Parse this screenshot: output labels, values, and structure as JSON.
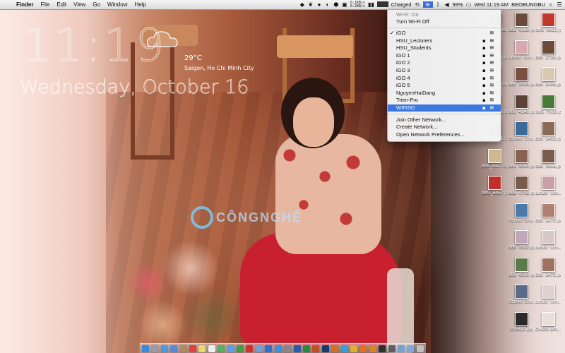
{
  "menubar": {
    "app_name": "Finder",
    "menus": [
      "File",
      "Edit",
      "View",
      "Go",
      "Window",
      "Help"
    ],
    "net_up": "0.1KB/s",
    "net_down": "0.2KB/s",
    "battery_percent": "99%",
    "battery_level": 0.99,
    "battery_status": "Charged",
    "clock": "Wed 11:19 AM",
    "username": "BEOBUNGBU"
  },
  "clock_widget": {
    "time": "11:19",
    "temperature": "29°C",
    "city": "Saigon, Ho Chi Minh City",
    "date": "Wednesday, October 16"
  },
  "watermark": {
    "text": "CÔNGNGHỆ"
  },
  "wifi_menu": {
    "status": "Wi-Fi: On",
    "toggle": "Turn Wi-Fi Off",
    "networks": [
      {
        "name": "iGO",
        "connected": true,
        "locked": false
      },
      {
        "name": "HSU_Lecturers",
        "connected": false,
        "locked": true
      },
      {
        "name": "HSU_Students",
        "connected": false,
        "locked": true
      },
      {
        "name": "iGO 1",
        "connected": false,
        "locked": true
      },
      {
        "name": "iGO 2",
        "connected": false,
        "locked": true
      },
      {
        "name": "iGO 3",
        "connected": false,
        "locked": true
      },
      {
        "name": "iGO 4",
        "connected": false,
        "locked": true
      },
      {
        "name": "iGO 5",
        "connected": false,
        "locked": true
      },
      {
        "name": "NguyenHaiDang",
        "connected": false,
        "locked": true
      },
      {
        "name": "Trien-Pro",
        "connected": false,
        "locked": true
      },
      {
        "name": "WIFISD",
        "connected": false,
        "locked": true,
        "highlighted": true
      }
    ],
    "actions": [
      "Join Other Network...",
      "Create Network...",
      "Open Network Preferences..."
    ]
  },
  "desktop_icons": [
    {
      "label": "IMG_6422.jpg",
      "color": "#c0392b"
    },
    {
      "label": "888_3726.jpg",
      "color": "#6b4a3a"
    },
    {
      "label": "888_3466.jpg",
      "color": "#d8c8b0"
    },
    {
      "label": "IMG_7008.jpg",
      "color": "#4a7a3a"
    },
    {
      "label": "888_3493.jpg",
      "color": "#8a6a5a"
    },
    {
      "label": "888_3566.jpg",
      "color": "#7a5a4a"
    },
    {
      "label": "tumblr_mm...jpg",
      "color": "#c9a0a8"
    },
    {
      "label": "888_3472.jpg",
      "color": "#b08070"
    },
    {
      "label": "tumblr_mm...jpg",
      "color": "#d9c8c8"
    },
    {
      "label": "888_3475.jpg",
      "color": "#a07060"
    },
    {
      "label": "tumblr_mm...jpg",
      "color": "#e0d0d0"
    },
    {
      "label": "CHON MA...AO",
      "color": "#e8e0d8"
    },
    {
      "label": "888_4168.jpg",
      "color": "#6a4a3a"
    },
    {
      "label": "tumblr_mm...jpg",
      "color": "#d8a8b0"
    },
    {
      "label": "888_3989.jpg",
      "color": "#7a5040"
    },
    {
      "label": "888_4148.jpg",
      "color": "#5a4035"
    },
    {
      "label": "Screen Sho...PM",
      "color": "#3a6a9a"
    },
    {
      "label": "888_3990.jpg",
      "color": "#8a6050"
    },
    {
      "label": "888_4708.jpg",
      "color": "#7a5a4a"
    },
    {
      "label": "Screen Sho...PM",
      "color": "#4a7aaa"
    },
    {
      "label": "888_3992.jpg",
      "color": "#c0a8b8"
    },
    {
      "label": "888_4599.jpg",
      "color": "#5a7a4a"
    },
    {
      "label": "Screen Sho...PM",
      "color": "#5a6a8a"
    },
    {
      "label": "235810.jpg",
      "color": "#2a2a2a"
    },
    {
      "label": "Screen Sho...AM",
      "color": "#3a5a8a"
    },
    {
      "label": "888_4068.jpg",
      "color": "#c0a080"
    },
    {
      "label": "1309281814.jpg",
      "color": "#d8d8d8"
    },
    {
      "label": "888_4178.jpg",
      "color": "#e0e0e8"
    },
    {
      "label": "IMG_6361.jpg",
      "color": "#3a5a7a"
    },
    {
      "label": "888_4447-2.jpg",
      "color": "#d0b890"
    },
    {
      "label": "IMG_6457.jpg",
      "color": "#c0302a"
    }
  ],
  "dock": {
    "items": [
      "finder",
      "launchpad",
      "safari",
      "mail",
      "contacts",
      "calendar",
      "notes",
      "reminders",
      "maps",
      "messages",
      "facetime",
      "photobooth",
      "iphoto",
      "itunes",
      "appstore",
      "preferences",
      "word",
      "excel",
      "powerpoint",
      "photoshop",
      "illustrator",
      "skype",
      "chrome",
      "firefox",
      "vlc",
      "terminal",
      "activity",
      "downloads",
      "folder",
      "trash"
    ],
    "colors": [
      "#3b8ad9",
      "#9a9aa8",
      "#4a9ae0",
      "#5a8ad0",
      "#b08a60",
      "#e04040",
      "#e8d870",
      "#f0f0f0",
      "#5ab060",
      "#5aa0e8",
      "#40a040",
      "#d03030",
      "#70a0d0",
      "#3070d0",
      "#3a90e0",
      "#888888",
      "#2a5aa8",
      "#2a8a3a",
      "#c0502a",
      "#1a3a6a",
      "#d07020",
      "#30a0e0",
      "#e0b030",
      "#e07020",
      "#e08020",
      "#303030",
      "#606060",
      "#7aa0d0",
      "#80a8d8",
      "#c0c0c0"
    ]
  }
}
